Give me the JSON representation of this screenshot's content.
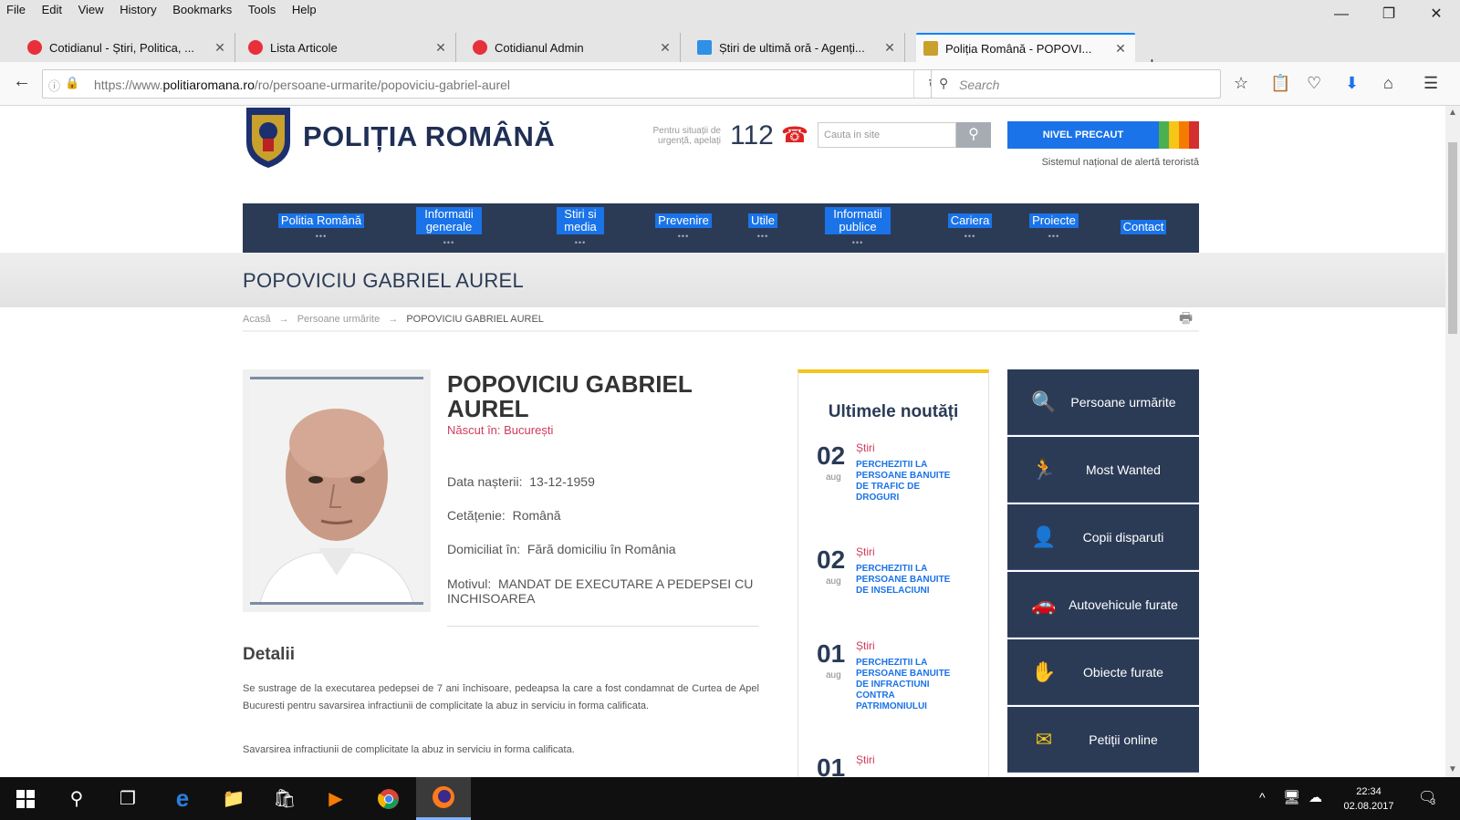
{
  "browser": {
    "menu": [
      "File",
      "Edit",
      "View",
      "History",
      "Bookmarks",
      "Tools",
      "Help"
    ],
    "tabs": [
      {
        "title": "Cotidianul - Știri, Politica, ...",
        "icon_color": "#e8303a"
      },
      {
        "title": "Lista Articole",
        "icon_color": "#e8303a"
      },
      {
        "title": "Cotidianul Admin",
        "icon_color": "#e8303a"
      },
      {
        "title": "Știri de ultimă oră - Agenți...",
        "icon_color": "#2e90e6"
      },
      {
        "title": "Poliția Română - POPOVI...",
        "icon_color": "#c8a02c"
      }
    ],
    "url_prefix": "https://www.",
    "url_domain": "politiaromana.ro",
    "url_path": "/ro/persoane-urmarite/popoviciu-gabriel-aurel",
    "search_placeholder": "Search"
  },
  "site": {
    "logo_text": "POLIȚIA ROMÂNĂ",
    "emergency_label": "Pentru situații de urgență, apelați",
    "emergency_number": "112",
    "search_placeholder": "Cauta in site",
    "alert_button": "NIVEL PRECAUT",
    "alert_caption": "Sistemul național de alertă teroristă",
    "nav": [
      {
        "label": "Politia Română",
        "dots": "•••"
      },
      {
        "label": "Informatii generale",
        "dots": "•••"
      },
      {
        "label": "Stiri si media",
        "dots": "•••"
      },
      {
        "label": "Prevenire",
        "dots": "•••"
      },
      {
        "label": "Utile",
        "dots": "•••"
      },
      {
        "label": "Informatii publice",
        "dots": "•••"
      },
      {
        "label": "Cariera",
        "dots": "•••"
      },
      {
        "label": "Proiecte",
        "dots": "•••"
      },
      {
        "label": "Contact",
        "dots": ""
      }
    ]
  },
  "page": {
    "title": "POPOVICIU GABRIEL AUREL",
    "breadcrumb": [
      "Acasă",
      "Persoane urmărite",
      "POPOVICIU GABRIEL AUREL"
    ],
    "person": {
      "name": "POPOVICIU GABRIEL AUREL",
      "born": "Născut în: București",
      "dob_label": "Data nașterii:",
      "dob": "13-12-1959",
      "citizenship_label": "Cetățenie:",
      "citizenship": "Română",
      "domicile_label": "Domiciliat în:",
      "domicile": "Fără domiciliu în România",
      "motive_label": "Motivul:",
      "motive": "MANDAT DE EXECUTARE A PEDEPSEI CU INCHISOAREA"
    },
    "details_heading": "Detalii",
    "details_p1": "Se sustrage de la executarea pedepsei de 7 ani închisoare, pedeapsa la care a fost condamnat de Curtea de Apel Bucuresti pentru savarsirea infractiunii de complicitate la abuz in serviciu in forma calificata.",
    "details_p2": "Savarsirea infractiunii de complicitate la abuz in serviciu in forma calificata.",
    "news_heading": "Ultimele noutăți",
    "news": [
      {
        "day": "02",
        "month": "aug",
        "category": "Știri",
        "title": "PERCHEZITII LA PERSOANE BANUITE DE TRAFIC DE DROGURI"
      },
      {
        "day": "02",
        "month": "aug",
        "category": "Știri",
        "title": "PERCHEZITII LA PERSOANE BANUITE DE INSELACIUNI"
      },
      {
        "day": "01",
        "month": "aug",
        "category": "Știri",
        "title": "PERCHEZITII LA PERSOANE BANUITE DE INFRACTIUNI CONTRA PATRIMONIULUI"
      },
      {
        "day": "01",
        "month": "",
        "category": "Știri",
        "title": ""
      }
    ],
    "sidebar": [
      {
        "label": "Persoane urmărite",
        "icon": "search-person-icon",
        "glyph": "🔍"
      },
      {
        "label": "Most Wanted",
        "icon": "running-person-icon",
        "glyph": "🏃"
      },
      {
        "label": "Copii disparuti",
        "icon": "child-icon",
        "glyph": "👤"
      },
      {
        "label": "Autovehicule furate",
        "icon": "car-icon",
        "glyph": "🚗"
      },
      {
        "label": "Obiecte furate",
        "icon": "hand-icon",
        "glyph": "✋"
      },
      {
        "label": "Petiții online",
        "icon": "envelope-icon",
        "glyph": "✉"
      }
    ]
  },
  "taskbar": {
    "time": "22:34",
    "date": "02.08.2017",
    "notification_count": "3"
  },
  "colors": {
    "navy": "#2b3b56",
    "link_blue": "#1a73e8",
    "accent_red": "#d23a5c",
    "news_border": "#f5c518"
  }
}
